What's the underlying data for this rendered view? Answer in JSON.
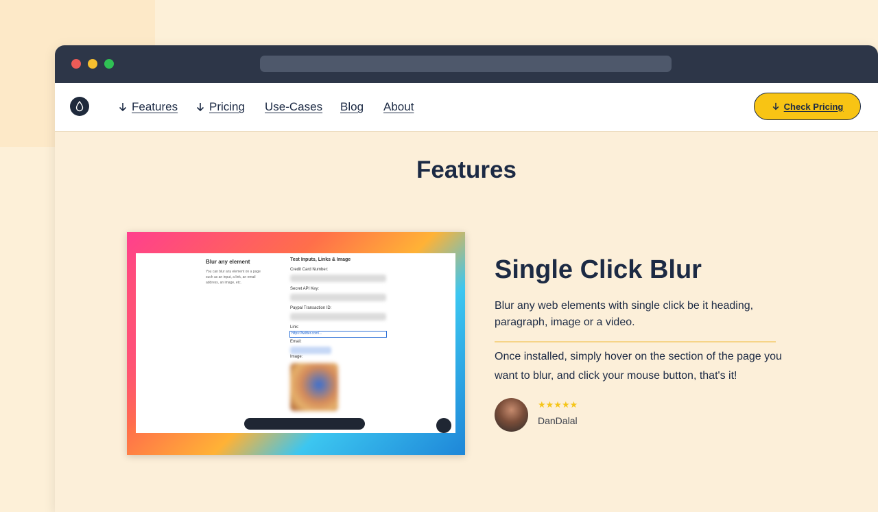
{
  "nav": {
    "links": [
      "Features",
      "Pricing",
      "Use-Cases",
      "Blog",
      "About"
    ],
    "cta": "Check Pricing"
  },
  "section": {
    "title": "Features"
  },
  "screenshot": {
    "left_title": "Blur any element",
    "left_desc": [
      "You can blur any element on a page",
      "such as an input, a link, an email",
      "address, an image, etc."
    ],
    "right_title": "Test Inputs, Links & Image",
    "labels": [
      "Credit Card Number:",
      "Secret API Key:",
      "Paypal Transaction ID:",
      "Link:",
      "Email:",
      "Image:"
    ],
    "link_value": "https://twitter.com/..."
  },
  "feature": {
    "title": "Single Click Blur",
    "p1": "Blur any web elements with single click be it heading, paragraph, image or a video.",
    "p2": "Once installed, simply hover on the section of the page you want to blur, and click your mouse button, that's it!",
    "stars": "★★★★★",
    "author": "DanDalal"
  },
  "colors": {
    "background": "#fdf0d8",
    "titlebar": "#2d3648",
    "cta": "#f8c414",
    "text": "#1c2a44",
    "separator": "#f6d487"
  }
}
